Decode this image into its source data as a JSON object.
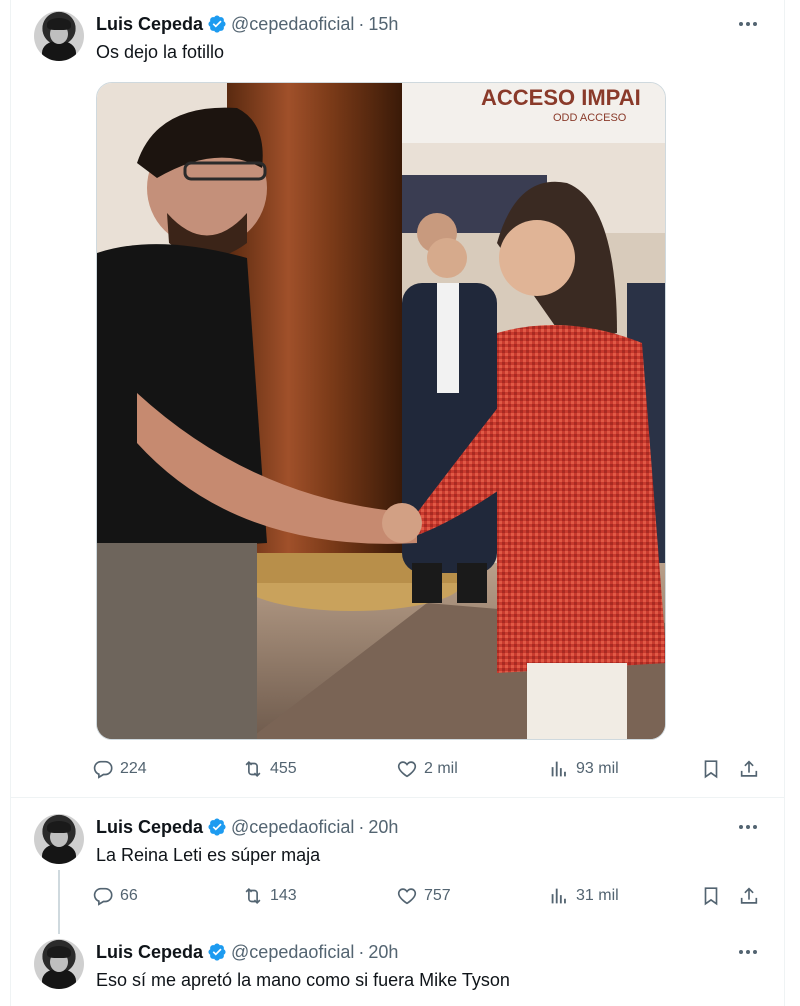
{
  "tweets": [
    {
      "author": "Luis Cepeda",
      "handle": "@cepedaoficial",
      "separator": "·",
      "time": "15h",
      "text": "Os dejo la fotillo",
      "image_signs": {
        "line1": "ACCESO IMPAI",
        "line2": "ODD ACCESO"
      },
      "metrics": {
        "replies": "224",
        "reposts": "455",
        "likes": "2 mil",
        "views": "93 mil"
      }
    },
    {
      "author": "Luis Cepeda",
      "handle": "@cepedaoficial",
      "separator": "·",
      "time": "20h",
      "text": "La Reina Leti es súper maja",
      "metrics": {
        "replies": "66",
        "reposts": "143",
        "likes": "757",
        "views": "31 mil"
      }
    },
    {
      "author": "Luis Cepeda",
      "handle": "@cepedaoficial",
      "separator": "·",
      "time": "20h",
      "text": "Eso sí me apretó la mano como si fuera Mike Tyson"
    }
  ],
  "icons": {
    "reply": "reply-icon",
    "repost": "repost-icon",
    "like": "like-icon",
    "views": "views-icon",
    "bookmark": "bookmark-icon",
    "share": "share-icon",
    "verified": "verified-badge-icon",
    "more": "more-icon"
  },
  "colors": {
    "verified": "#1d9bf0",
    "text": "#0f1419",
    "muted": "#536471",
    "border": "#eff3f4"
  }
}
